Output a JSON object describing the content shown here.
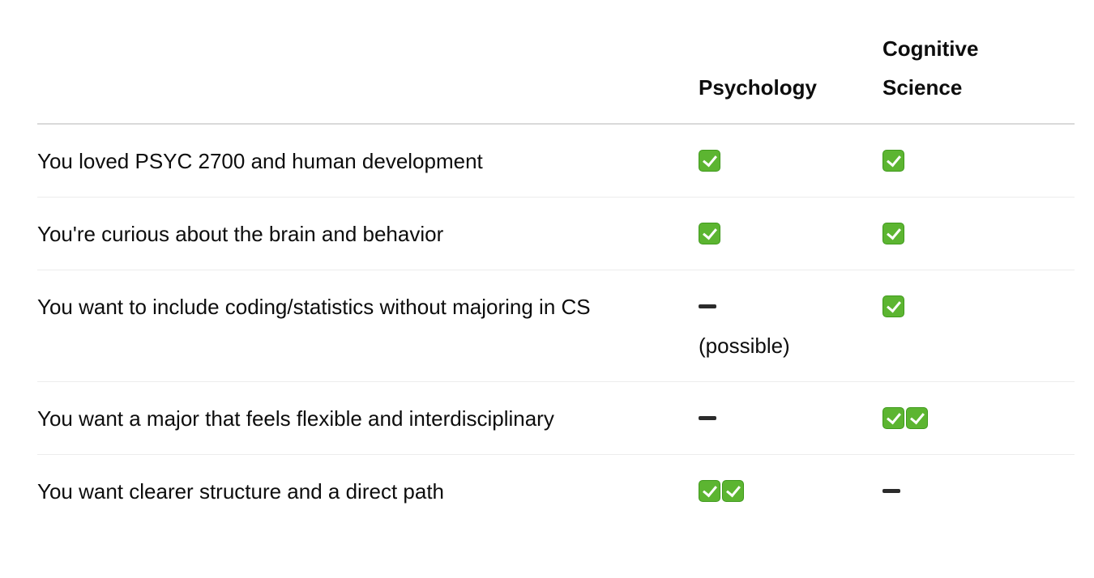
{
  "table": {
    "headers": [
      "",
      "Psychology",
      "Cognitive Science"
    ],
    "rows": [
      {
        "label": "You loved PSYC 2700 and human development",
        "psychology": {
          "icon": "check-icon",
          "count": 1,
          "note": ""
        },
        "cogsci": {
          "icon": "check-icon",
          "count": 1,
          "note": ""
        }
      },
      {
        "label": "You're curious about the brain and behavior",
        "psychology": {
          "icon": "check-icon",
          "count": 1,
          "note": ""
        },
        "cogsci": {
          "icon": "check-icon",
          "count": 1,
          "note": ""
        }
      },
      {
        "label": "You want to include coding/statistics without majoring in CS",
        "psychology": {
          "icon": "dash-icon",
          "count": 1,
          "note": "(possible)"
        },
        "cogsci": {
          "icon": "check-icon",
          "count": 1,
          "note": ""
        }
      },
      {
        "label": "You want a major that feels flexible and interdisciplinary",
        "psychology": {
          "icon": "dash-icon",
          "count": 1,
          "note": ""
        },
        "cogsci": {
          "icon": "check-icon",
          "count": 2,
          "note": ""
        }
      },
      {
        "label": "You want clearer structure and a direct path",
        "psychology": {
          "icon": "check-icon",
          "count": 2,
          "note": ""
        },
        "cogsci": {
          "icon": "dash-icon",
          "count": 1,
          "note": ""
        }
      }
    ]
  },
  "colors": {
    "check_green": "#5cb531",
    "dash_dark": "#2b2b2b",
    "header_rule": "#d9d9d9",
    "row_rule": "#ececec"
  }
}
